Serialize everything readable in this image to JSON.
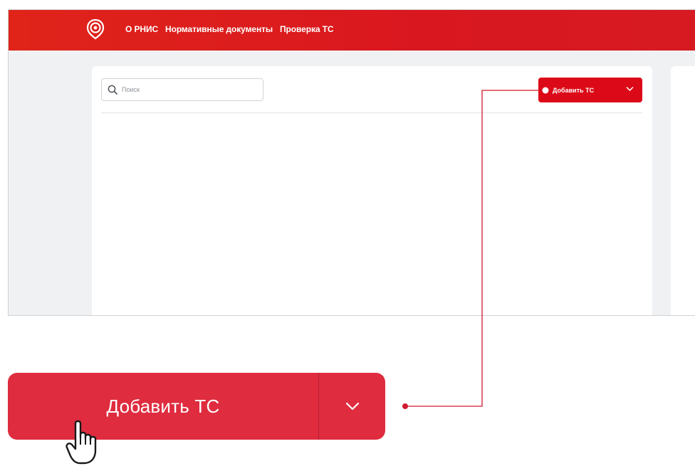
{
  "header": {
    "logo_icon": "rnis-logo-icon",
    "nav": [
      {
        "label": "О РНИС"
      },
      {
        "label": "Нормативные документы"
      },
      {
        "label": "Проверка ТС"
      }
    ]
  },
  "search": {
    "placeholder": "Поиск",
    "icon": "search-icon"
  },
  "toolbar": {
    "add_label": "Добавить ТС",
    "dropdown_icon": "chevron-down-icon"
  },
  "callout": {
    "add_label": "Добавить ТС",
    "dropdown_icon": "chevron-down-icon",
    "cursor_icon": "hand-pointer-icon"
  },
  "colors": {
    "header_red": "#dc1a1f",
    "button_red": "#dc0a18",
    "callout_red": "#df2c3f",
    "connector": "#d0192f"
  }
}
